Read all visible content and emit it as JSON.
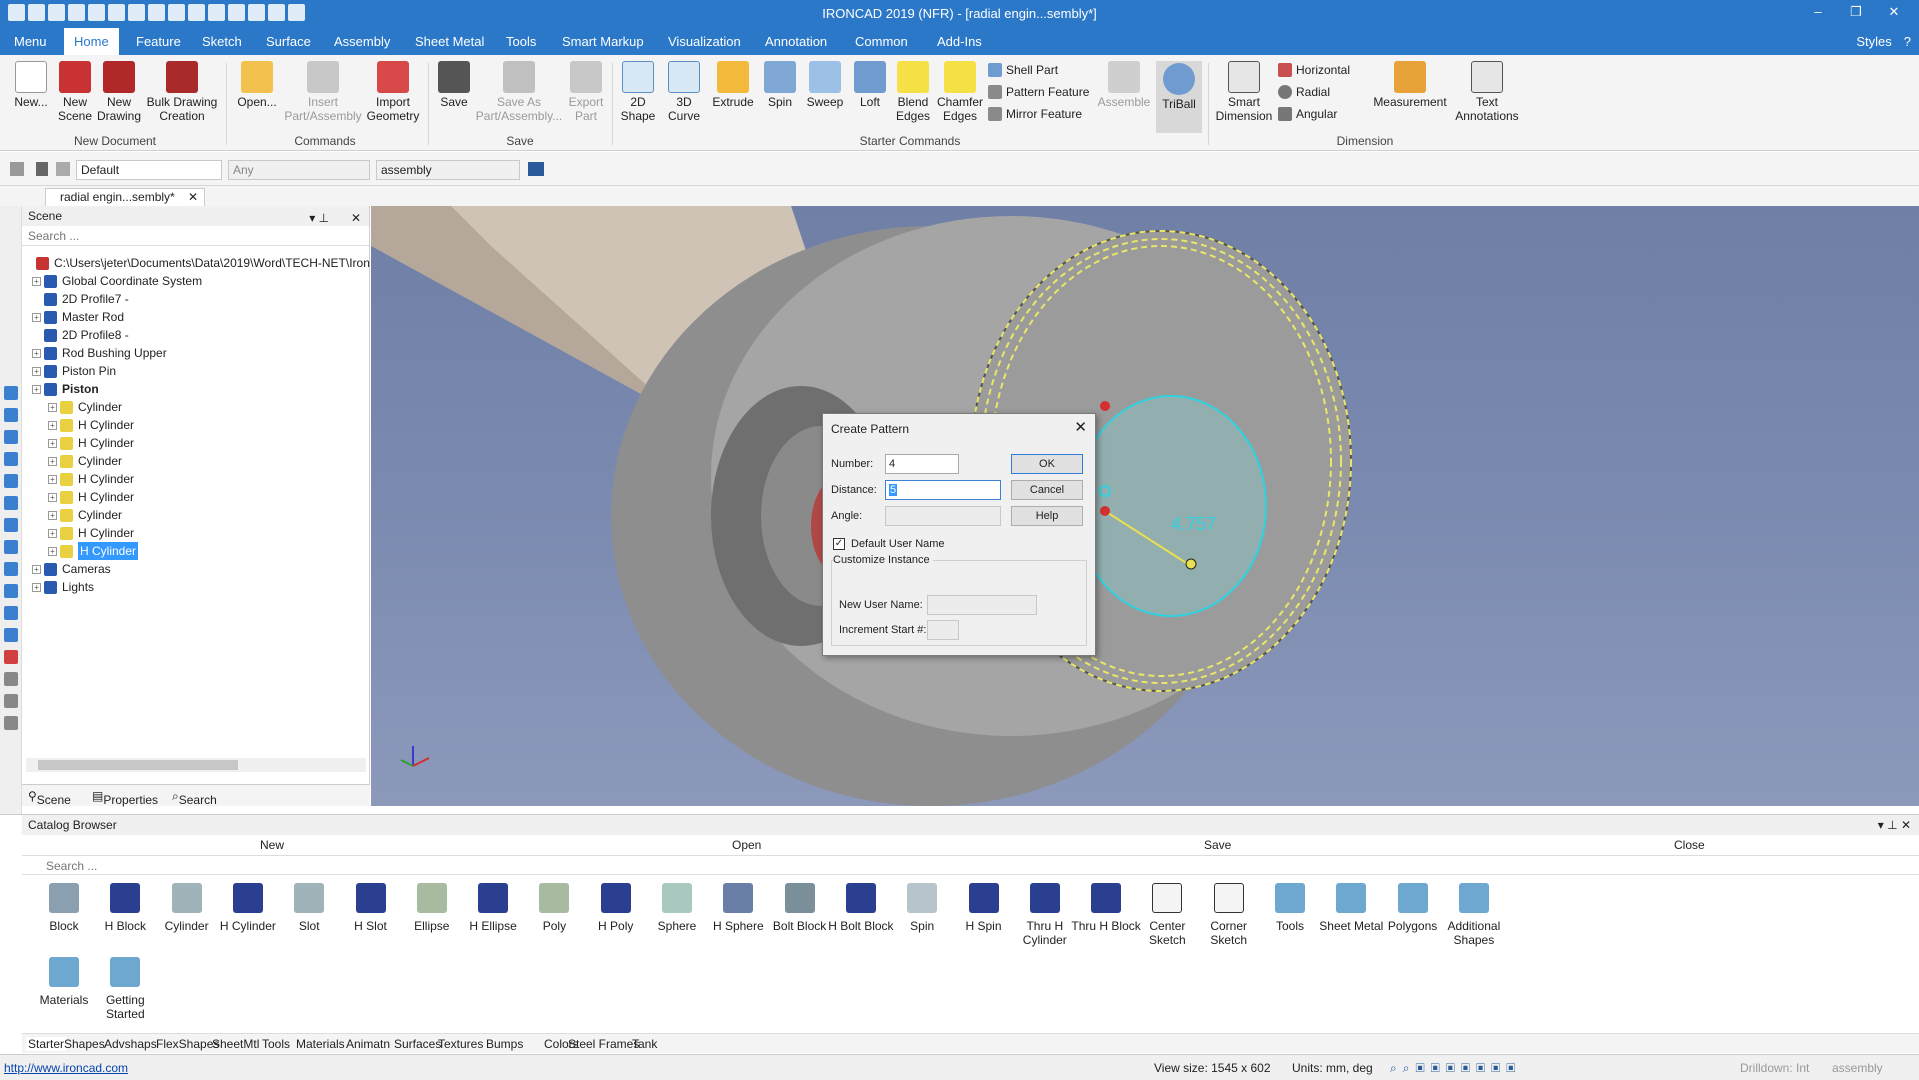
{
  "window": {
    "title": "IRONCAD 2019 (NFR) - [radial engin...sembly*]",
    "controls": [
      "–",
      "❐",
      "✕"
    ]
  },
  "ribbon_tabs": [
    {
      "label": "Menu"
    },
    {
      "label": "Home"
    },
    {
      "label": "Feature"
    },
    {
      "label": "Sketch"
    },
    {
      "label": "Surface"
    },
    {
      "label": "Assembly"
    },
    {
      "label": "Sheet Metal"
    },
    {
      "label": "Tools"
    },
    {
      "label": "Smart Markup"
    },
    {
      "label": "Visualization"
    },
    {
      "label": "Annotation"
    },
    {
      "label": "Common"
    },
    {
      "label": "Add-Ins"
    }
  ],
  "styles_label": "Styles",
  "ribbon": {
    "buttons": [
      {
        "l1": "New...",
        "l2": ""
      },
      {
        "l1": "New",
        "l2": "Scene"
      },
      {
        "l1": "New",
        "l2": "Drawing"
      },
      {
        "l1": "Bulk Drawing",
        "l2": "Creation"
      },
      {
        "l1": "Open...",
        "l2": ""
      },
      {
        "l1": "Insert",
        "l2": "Part/Assembly"
      },
      {
        "l1": "Import",
        "l2": "Geometry"
      },
      {
        "l1": "Save",
        "l2": ""
      },
      {
        "l1": "Save As",
        "l2": "Part/Assembly..."
      },
      {
        "l1": "Export",
        "l2": "Part"
      },
      {
        "l1": "2D",
        "l2": "Shape"
      },
      {
        "l1": "3D",
        "l2": "Curve"
      },
      {
        "l1": "Extrude",
        "l2": ""
      },
      {
        "l1": "Spin",
        "l2": ""
      },
      {
        "l1": "Sweep",
        "l2": ""
      },
      {
        "l1": "Loft",
        "l2": ""
      },
      {
        "l1": "Blend",
        "l2": "Edges"
      },
      {
        "l1": "Chamfer",
        "l2": "Edges"
      },
      {
        "l1": "Assemble",
        "l2": ""
      },
      {
        "l1": "TriBall",
        "l2": ""
      },
      {
        "l1": "Smart",
        "l2": "Dimension"
      },
      {
        "l1": "Measurement",
        "l2": ""
      },
      {
        "l1": "Text",
        "l2": "Annotations"
      }
    ],
    "small": [
      {
        "label": "Shell Part"
      },
      {
        "label": "Pattern Feature"
      },
      {
        "label": "Mirror Feature"
      },
      {
        "label": "Horizontal"
      },
      {
        "label": "Radial"
      },
      {
        "label": "Angular"
      }
    ],
    "groups": [
      {
        "label": "New Document"
      },
      {
        "label": "Commands"
      },
      {
        "label": "Save"
      },
      {
        "label": "Starter Commands"
      },
      {
        "label": "Dimension"
      }
    ]
  },
  "toolbar2": {
    "style_value": "Default",
    "filter_value": "Any",
    "mode_value": "assembly"
  },
  "doc_tab": {
    "label": "radial engin...sembly*"
  },
  "scene_panel": {
    "title": "Scene",
    "search_placeholder": "Search ...",
    "tree": [
      {
        "label": "C:\\Users\\jeter\\Documents\\Data\\2019\\Word\\TECH-NET\\Iron",
        "level": 0,
        "bold": false,
        "sel": false,
        "exp": false
      },
      {
        "label": "Global Coordinate System",
        "level": 1,
        "bold": false,
        "sel": false,
        "exp": true
      },
      {
        "label": "2D Profile7 -",
        "level": 1,
        "bold": false,
        "sel": false,
        "exp": false
      },
      {
        "label": "Master Rod",
        "level": 1,
        "bold": false,
        "sel": false,
        "exp": true
      },
      {
        "label": "2D Profile8 -",
        "level": 1,
        "bold": false,
        "sel": false,
        "exp": false
      },
      {
        "label": "Rod Bushing Upper",
        "level": 1,
        "bold": false,
        "sel": false,
        "exp": true
      },
      {
        "label": "Piston Pin",
        "level": 1,
        "bold": false,
        "sel": false,
        "exp": true
      },
      {
        "label": "Piston",
        "level": 1,
        "bold": true,
        "sel": false,
        "exp": true
      },
      {
        "label": "Cylinder",
        "level": 2,
        "bold": false,
        "sel": false,
        "exp": true
      },
      {
        "label": "H Cylinder",
        "level": 2,
        "bold": false,
        "sel": false,
        "exp": true
      },
      {
        "label": "H Cylinder",
        "level": 2,
        "bold": false,
        "sel": false,
        "exp": true
      },
      {
        "label": "Cylinder",
        "level": 2,
        "bold": false,
        "sel": false,
        "exp": true
      },
      {
        "label": "H Cylinder",
        "level": 2,
        "bold": false,
        "sel": false,
        "exp": true
      },
      {
        "label": "H Cylinder",
        "level": 2,
        "bold": false,
        "sel": false,
        "exp": true
      },
      {
        "label": "Cylinder",
        "level": 2,
        "bold": false,
        "sel": false,
        "exp": true
      },
      {
        "label": "H Cylinder",
        "level": 2,
        "bold": false,
        "sel": false,
        "exp": true
      },
      {
        "label": "H Cylinder",
        "level": 2,
        "bold": false,
        "sel": true,
        "exp": true
      },
      {
        "label": "Cameras",
        "level": 1,
        "bold": false,
        "sel": false,
        "exp": true
      },
      {
        "label": "Lights",
        "level": 1,
        "bold": false,
        "sel": false,
        "exp": true
      }
    ],
    "tabs": [
      {
        "label": "Scene"
      },
      {
        "label": "Properties"
      },
      {
        "label": "Search"
      }
    ]
  },
  "viewport": {
    "dimension_label": "4.757"
  },
  "dialog": {
    "title": "Create Pattern",
    "number_label": "Number:",
    "number_value": "4",
    "distance_label": "Distance:",
    "distance_value": "5",
    "angle_label": "Angle:",
    "ok": "OK",
    "cancel": "Cancel",
    "help": "Help",
    "default_user_name": "Default User Name",
    "customize": "Customize Instance",
    "new_user_name": "New User Name:",
    "increment_start": "Increment Start #:"
  },
  "catalog": {
    "title": "Catalog Browser",
    "actions": [
      {
        "label": "New"
      },
      {
        "label": "Open"
      },
      {
        "label": "Save"
      },
      {
        "label": "Close"
      }
    ],
    "search_placeholder": "Search ...",
    "items": [
      {
        "l1": "Block",
        "l2": "",
        "color": "#8aa0b0"
      },
      {
        "l1": "H Block",
        "l2": "",
        "color": "#2a3f8f"
      },
      {
        "l1": "Cylinder",
        "l2": "",
        "color": "#9fb3b8"
      },
      {
        "l1": "H Cylinder",
        "l2": "",
        "color": "#2a3f8f"
      },
      {
        "l1": "Slot",
        "l2": "",
        "color": "#9fb3b8"
      },
      {
        "l1": "H Slot",
        "l2": "",
        "color": "#2a3f8f"
      },
      {
        "l1": "Ellipse",
        "l2": "",
        "color": "#a8bba0"
      },
      {
        "l1": "H Ellipse",
        "l2": "",
        "color": "#2a3f8f"
      },
      {
        "l1": "Poly",
        "l2": "",
        "color": "#a8bba0"
      },
      {
        "l1": "H Poly",
        "l2": "",
        "color": "#2a3f8f"
      },
      {
        "l1": "Sphere",
        "l2": "",
        "color": "#a8c8c0"
      },
      {
        "l1": "H Sphere",
        "l2": "",
        "color": "#6a7fa8"
      },
      {
        "l1": "Bolt Block",
        "l2": "",
        "color": "#7a8f9a"
      },
      {
        "l1": "H Bolt Block",
        "l2": "",
        "color": "#2a3f8f"
      },
      {
        "l1": "Spin",
        "l2": "",
        "color": "#b8c4cc"
      },
      {
        "l1": "H Spin",
        "l2": "",
        "color": "#2a3f8f"
      },
      {
        "l1": "Thru H",
        "l2": "Cylinder",
        "color": "#2a3f8f"
      },
      {
        "l1": "Thru H Block",
        "l2": "",
        "color": "#2a3f8f"
      },
      {
        "l1": "Center",
        "l2": "Sketch",
        "color": "#f4f4f4"
      },
      {
        "l1": "Corner",
        "l2": "Sketch",
        "color": "#f4f4f4"
      },
      {
        "l1": "Tools",
        "l2": "",
        "color": "#6ea8d0"
      },
      {
        "l1": "Sheet Metal",
        "l2": "",
        "color": "#6ea8d0"
      },
      {
        "l1": "Polygons",
        "l2": "",
        "color": "#6ea8d0"
      },
      {
        "l1": "Additional",
        "l2": "Shapes",
        "color": "#6ea8d0"
      },
      {
        "l1": "Materials",
        "l2": "",
        "color": "#6ea8d0"
      },
      {
        "l1": "Getting",
        "l2": "Started",
        "color": "#6ea8d0"
      }
    ],
    "tabs": [
      {
        "label": "Starter"
      },
      {
        "label": "Shapes"
      },
      {
        "label": "Advshaps"
      },
      {
        "label": "FlexShapes"
      },
      {
        "label": "SheetMtl"
      },
      {
        "label": "Tools"
      },
      {
        "label": "Materials"
      },
      {
        "label": "Animatn"
      },
      {
        "label": "Surfaces"
      },
      {
        "label": "Textures"
      },
      {
        "label": "Bumps"
      },
      {
        "label": "Colors"
      },
      {
        "label": "Steel Frames"
      },
      {
        "label": "Tank"
      }
    ]
  },
  "status": {
    "url": "http://www.ironcad.com",
    "view_size": "View size: 1545 x 602",
    "units": "Units: mm, deg",
    "drilldown": "Drilldown: Int",
    "mode": "assembly"
  }
}
